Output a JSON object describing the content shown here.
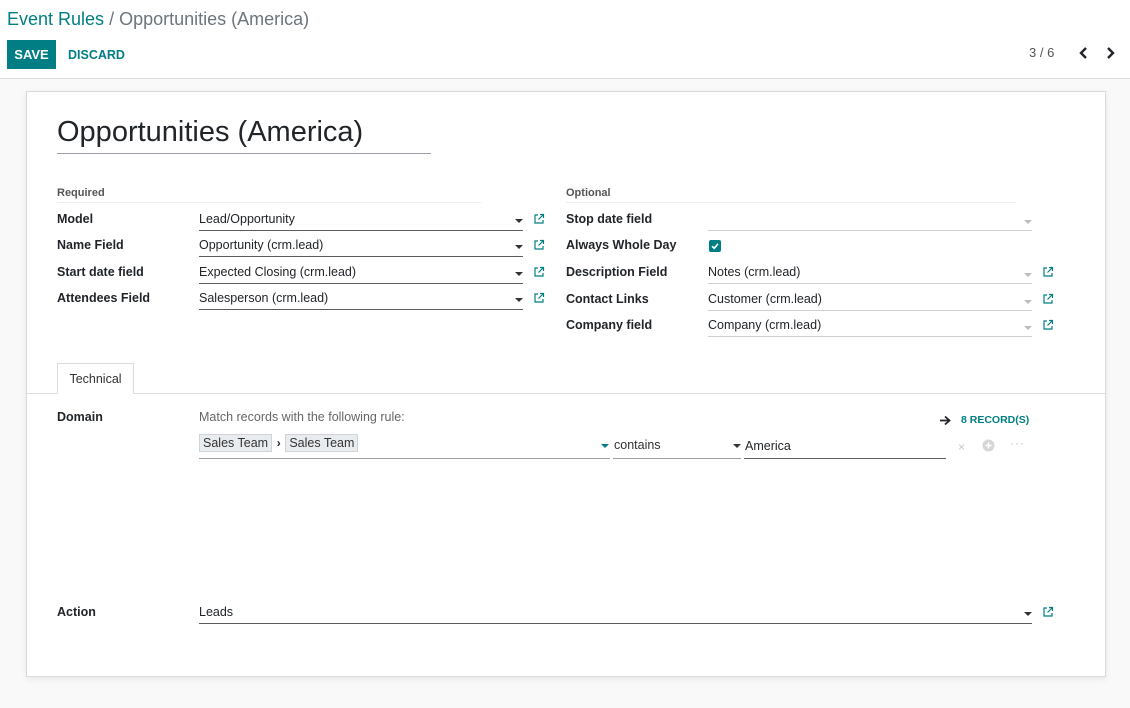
{
  "breadcrumb": {
    "parent": "Event Rules",
    "separator": " / ",
    "current": "Opportunities (America)"
  },
  "buttons": {
    "save": "SAVE",
    "discard": "DISCARD"
  },
  "pager": {
    "value": "3 / 6"
  },
  "record": {
    "name": "Opportunities (America)"
  },
  "required": {
    "title": "Required",
    "model_label": "Model",
    "model_value": "Lead/Opportunity",
    "name_label": "Name Field",
    "name_value": "Opportunity (crm.lead)",
    "start_label": "Start date field",
    "start_value": "Expected Closing (crm.lead)",
    "attendees_label": "Attendees Field",
    "attendees_value": "Salesperson (crm.lead)"
  },
  "optional": {
    "title": "Optional",
    "stop_label": "Stop date field",
    "stop_value": "",
    "whole_day_label": "Always Whole Day",
    "whole_day_checked": true,
    "description_label": "Description Field",
    "description_value": "Notes (crm.lead)",
    "contact_label": "Contact Links",
    "contact_value": "Customer (crm.lead)",
    "company_label": "Company field",
    "company_value": "Company (crm.lead)"
  },
  "tabs": [
    {
      "label": "Technical",
      "active": true
    }
  ],
  "domain": {
    "label": "Domain",
    "help": "Match records with the following rule:",
    "records": "8 RECORD(S)",
    "path": [
      "Sales Team",
      "Sales Team"
    ],
    "operator": "contains",
    "value": "America"
  },
  "action": {
    "label": "Action",
    "value": "Leads"
  },
  "colors": {
    "accent": "#017e84",
    "text": "#212529",
    "muted": "#6c757d"
  },
  "icons": [
    "external-link-icon",
    "chevron-left-icon",
    "chevron-right-icon",
    "arrow-right-icon",
    "close-icon",
    "add-circle-icon",
    "ellipsis-icon",
    "check-icon"
  ]
}
